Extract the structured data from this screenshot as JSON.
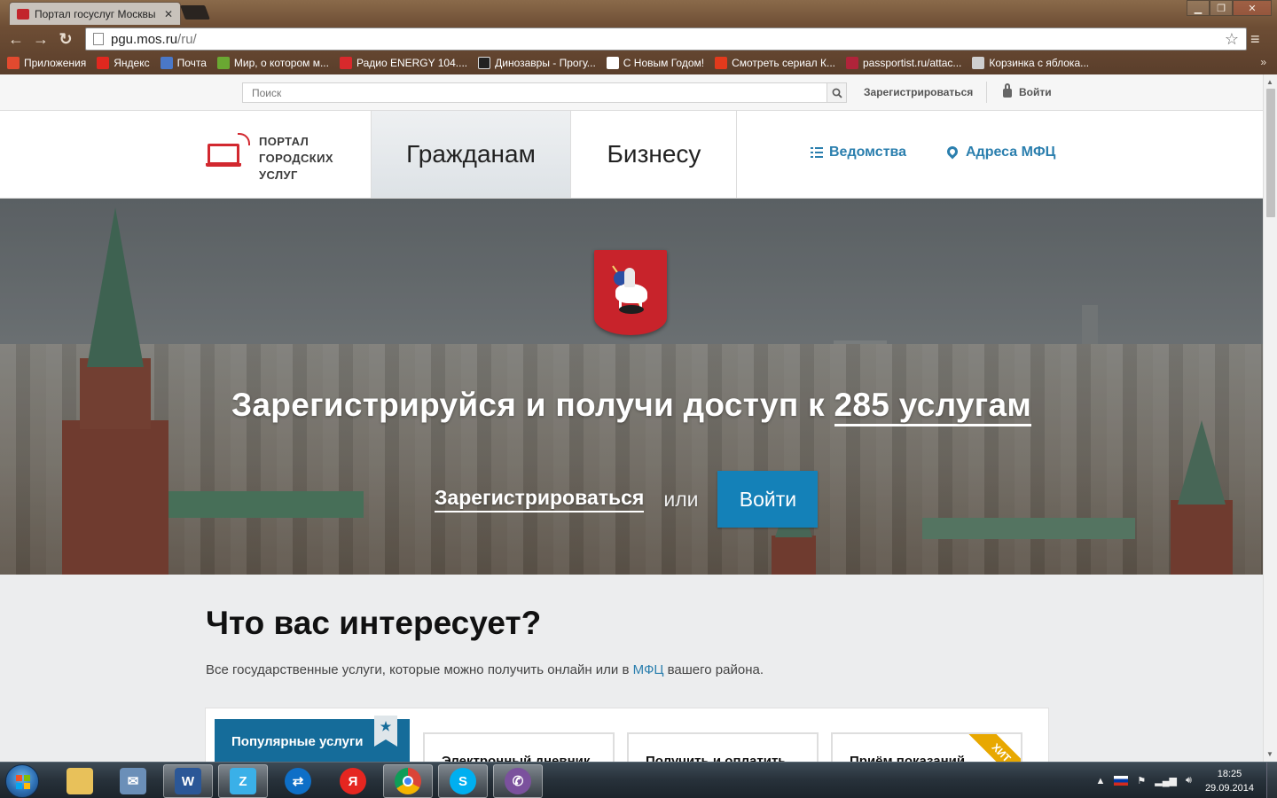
{
  "browser": {
    "tab_title": "Портал госуслуг Москвы",
    "url_host": "pgu.mos.ru",
    "url_path": "/ru/",
    "bookmarks": [
      {
        "label": "Приложения",
        "icon": "apps-grid-icon",
        "color": "#e24a2f"
      },
      {
        "label": "Яндекс",
        "icon": "yandex-icon",
        "color": "#e0281f"
      },
      {
        "label": "Почта",
        "icon": "mail-icon",
        "color": "#4a78c8"
      },
      {
        "label": "Мир, о котором м...",
        "icon": "game-icon",
        "color": "#6aa832"
      },
      {
        "label": "Радио ENERGY 104....",
        "icon": "radio-icon",
        "color": "#d8292c"
      },
      {
        "label": "Динозавры - Прогу...",
        "icon": "bbc-icon",
        "color": "#222222"
      },
      {
        "label": "С Новым Годом!",
        "icon": "page-icon",
        "color": "#ffffff"
      },
      {
        "label": "Смотреть сериал К...",
        "icon": "ctc-icon",
        "color": "#e23a1c"
      },
      {
        "label": "passportist.ru/attac...",
        "icon": "page-red-icon",
        "color": "#b0243a"
      },
      {
        "label": "Корзинка с яблока...",
        "icon": "basket-icon",
        "color": "#cfcfcf"
      }
    ],
    "bookmarks_more": "»"
  },
  "utilbar": {
    "search_placeholder": "Поиск",
    "register_label": "Зарегистрироваться",
    "login_label": "Войти"
  },
  "mainnav": {
    "logo_lines": [
      "ПОРТАЛ",
      "ГОРОДСКИХ",
      "УСЛУГ"
    ],
    "tab_citizens": "Гражданам",
    "tab_business": "Бизнесу",
    "link_agencies": "Ведомства",
    "link_mfc": "Адреса МФЦ"
  },
  "hero": {
    "title_prefix": "Зарегистрируйся и получи доступ к ",
    "title_count": "285 услугам",
    "register_label": "Зарегистрироваться",
    "or_label": "или",
    "login_label": "Войти"
  },
  "interests": {
    "title": "Что вас интересует?",
    "subtitle_before": "Все государственные услуги, которые можно получить онлайн или в ",
    "subtitle_link": "МФЦ",
    "subtitle_after": " вашего района.",
    "popular_tab": "Популярные услуги",
    "cards": [
      "Электронный дневник",
      "Получить и оплатить",
      "Приём показаний"
    ],
    "hit_badge": "ХИТ"
  },
  "taskbar": {
    "apps": [
      "explorer",
      "mail",
      "word",
      "zsky",
      "teamviewer",
      "yandex-browser",
      "chrome",
      "skype",
      "viber"
    ],
    "time": "18:25",
    "date": "29.09.2014"
  },
  "colors": {
    "accent": "#2b7fae",
    "login_button": "#1481b8",
    "popular_tab": "#156c9a",
    "brand_red": "#d2282f"
  }
}
